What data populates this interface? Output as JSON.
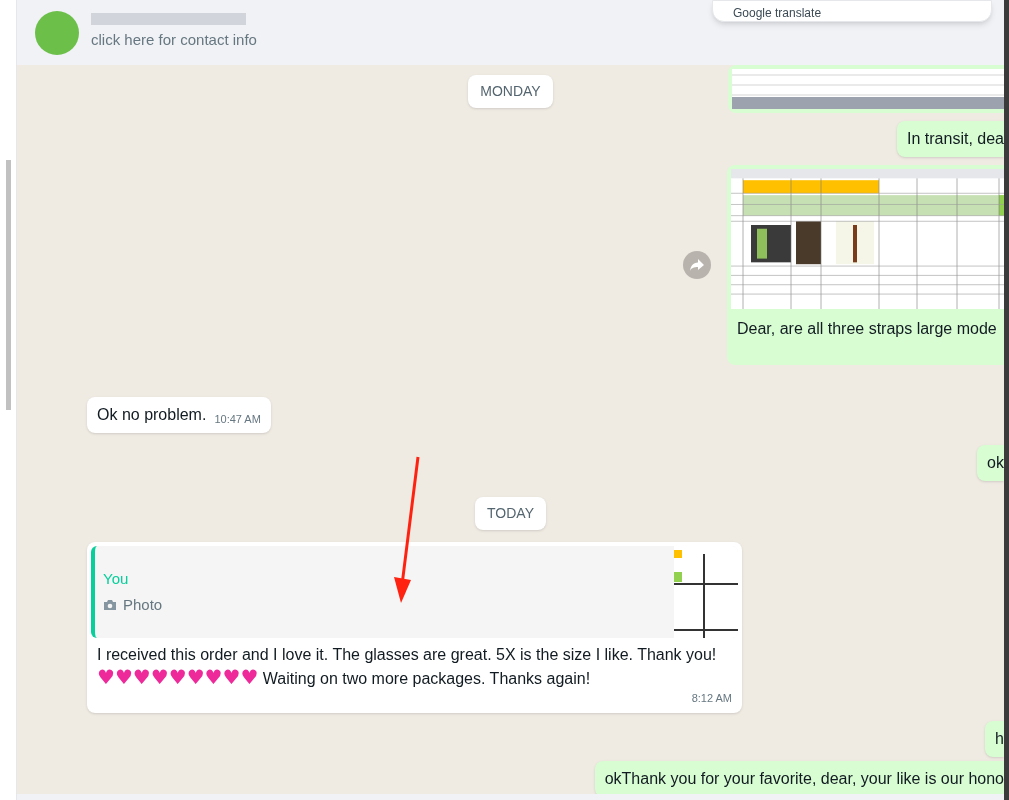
{
  "header": {
    "subtitle": "click here for contact info",
    "popup": "Google translate"
  },
  "sticky_date": "MONDAY",
  "messages": [
    {
      "kind": "image",
      "outgoing": true,
      "forward": false
    },
    {
      "kind": "text",
      "outgoing": true,
      "text": "In transit, dea"
    },
    {
      "kind": "image",
      "outgoing": true,
      "caption": "Dear, are all three straps large mode",
      "forward": true
    },
    {
      "kind": "text",
      "outgoing": false,
      "text": "Ok no problem.",
      "time": "10:47 AM"
    },
    {
      "kind": "text",
      "outgoing": true,
      "text": "ok"
    },
    {
      "kind": "date",
      "text": "TODAY"
    },
    {
      "kind": "reply",
      "outgoing": false,
      "quote_author": "You",
      "quote_text": "Photo",
      "text": "I received this order and I love it. The glasses are great. 5X is the size I like. Thank you!",
      "hearts": "♥♥♥♥♥♥♥♥♥",
      "text_after": "Waiting on two more packages. Thanks again!",
      "time": "8:12 AM"
    },
    {
      "kind": "text",
      "outgoing": true,
      "text": "h"
    },
    {
      "kind": "text",
      "outgoing": true,
      "text": "okThank you for your favorite, dear, your like is our hono"
    }
  ]
}
